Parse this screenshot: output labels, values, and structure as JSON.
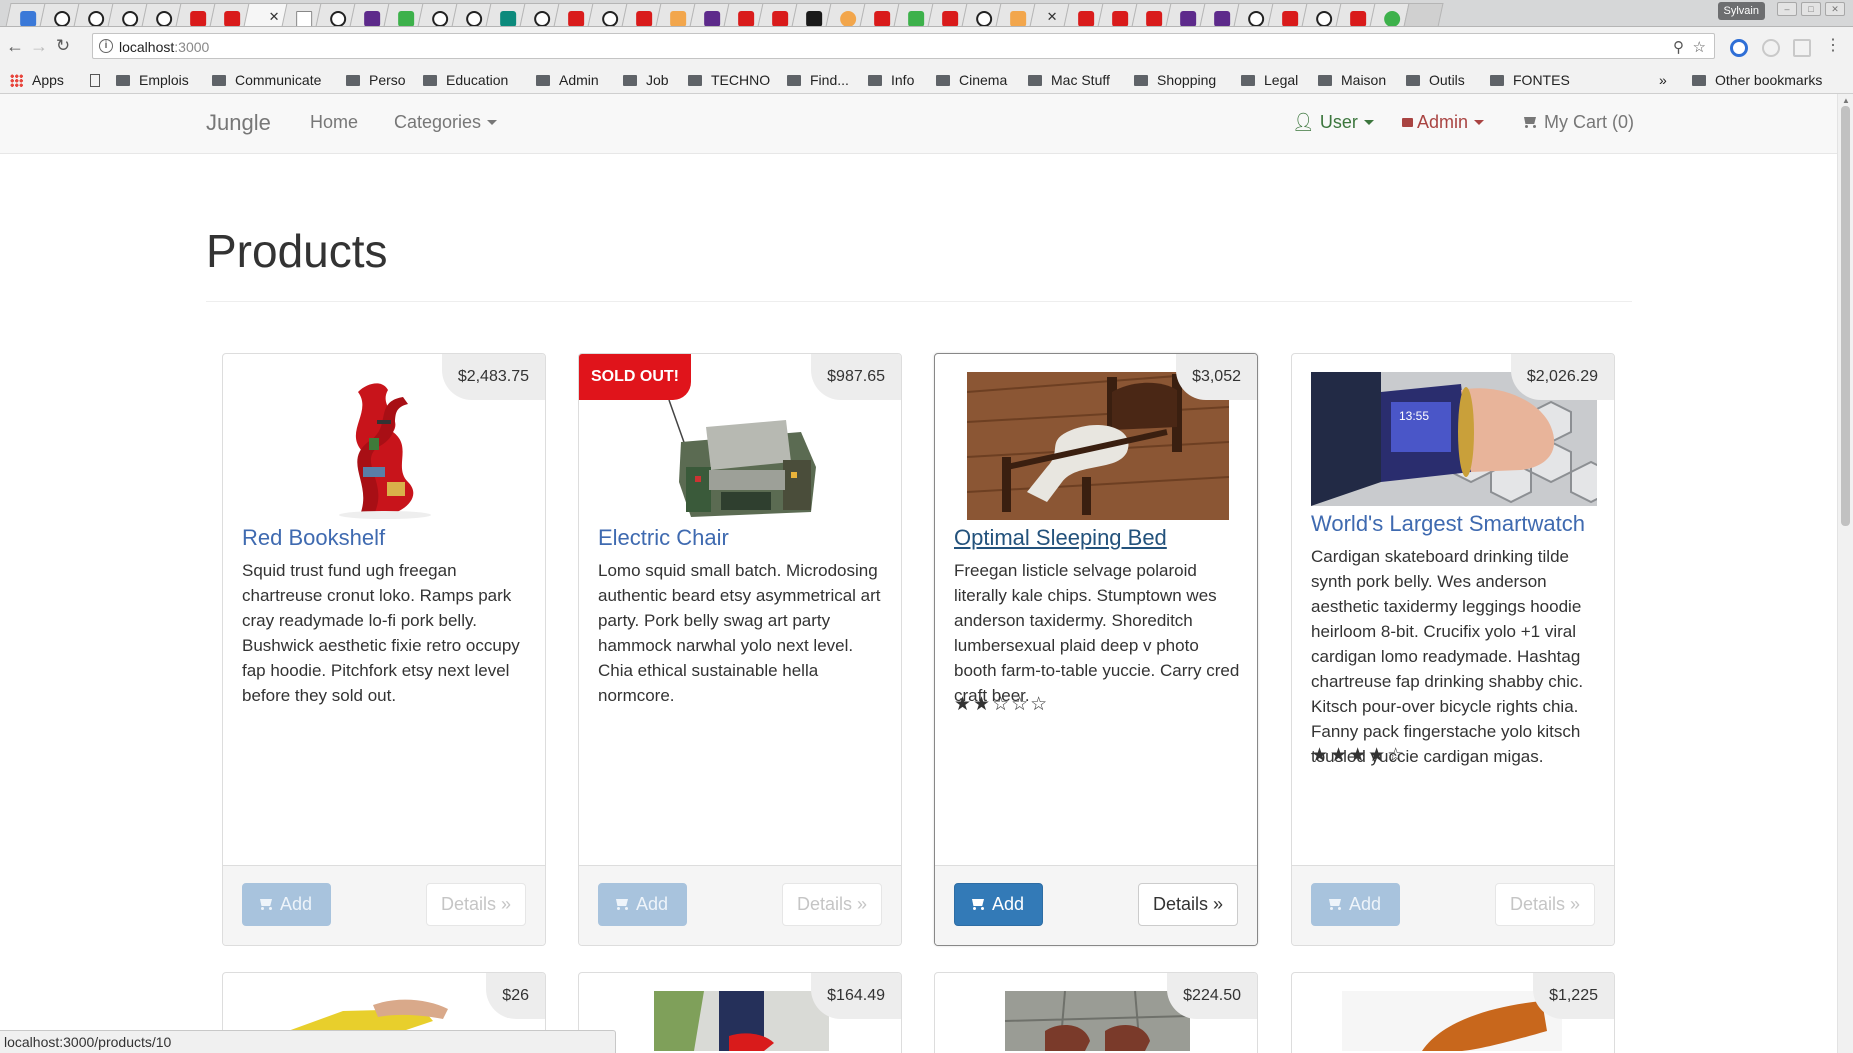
{
  "browser": {
    "profile_name": "Sylvain",
    "url_host": "localhost",
    "url_port": ":3000",
    "status_url": "localhost:3000/products/10",
    "bookmarks": [
      "Apps",
      "Emplois",
      "Communicate",
      "Perso",
      "Education",
      "Admin",
      "Job",
      "TECHNO",
      "Find...",
      "Info",
      "Cinema",
      "Mac Stuff",
      "Shopping",
      "Legal",
      "Maison",
      "Outils",
      "FONTES"
    ],
    "overflow_label": "»",
    "other_bookmarks": "Other bookmarks"
  },
  "navbar": {
    "brand": "Jungle",
    "home": "Home",
    "categories": "Categories",
    "user": "User",
    "admin": "Admin",
    "cart": "My Cart (0)",
    "colors": {
      "user": "#3c763d",
      "admin": "#a94442",
      "link": "#777777"
    }
  },
  "page": {
    "title": "Products"
  },
  "products": [
    {
      "name": "Red Bookshelf",
      "price": "$2,483.75",
      "description": "Squid trust fund ugh freegan chartreuse cronut loko. Ramps park cray readymade lo-fi pork belly. Bushwick aesthetic fixie retro occupy fap hoodie. Pitchfork etsy next level before they sold out.",
      "sold_out": false,
      "rating": null,
      "add_label": "Add",
      "details_label": "Details »"
    },
    {
      "name": "Electric Chair",
      "price": "$987.65",
      "badge": "SOLD OUT!",
      "description": "Lomo squid small batch. Microdosing authentic beard etsy asymmetrical art party. Pork belly swag art party hammock narwhal yolo next level. Chia ethical sustainable hella normcore.",
      "sold_out": true,
      "rating": null,
      "add_label": "Add",
      "details_label": "Details »"
    },
    {
      "name": "Optimal Sleeping Bed",
      "price": "$3,052",
      "description": "Freegan listicle selvage polaroid literally kale chips. Stumptown wes anderson taxidermy. Shoreditch lumbersexual plaid deep v photo booth farm-to-table yuccie. Carry cred craft beer.",
      "sold_out": false,
      "rating": 2,
      "stars": "★★☆☆☆",
      "add_label": "Add",
      "details_label": "Details »"
    },
    {
      "name": "World's Largest Smartwatch",
      "price": "$2,026.29",
      "description": "Cardigan skateboard drinking tilde synth pork belly. Wes anderson aesthetic taxidermy leggings hoodie heirloom 8-bit. Crucifix yolo +1 viral cardigan lomo readymade. Hashtag chartreuse fap drinking shabby chic. Kitsch pour-over bicycle rights chia. Fanny pack fingerstache yolo kitsch tousled yuccie cardigan migas.",
      "sold_out": false,
      "rating": 4,
      "stars": "★★★★☆",
      "add_label": "Add",
      "details_label": "Details »"
    }
  ],
  "second_row_prices": [
    "$26",
    "$164.49",
    "$224.50",
    "$1,225"
  ]
}
